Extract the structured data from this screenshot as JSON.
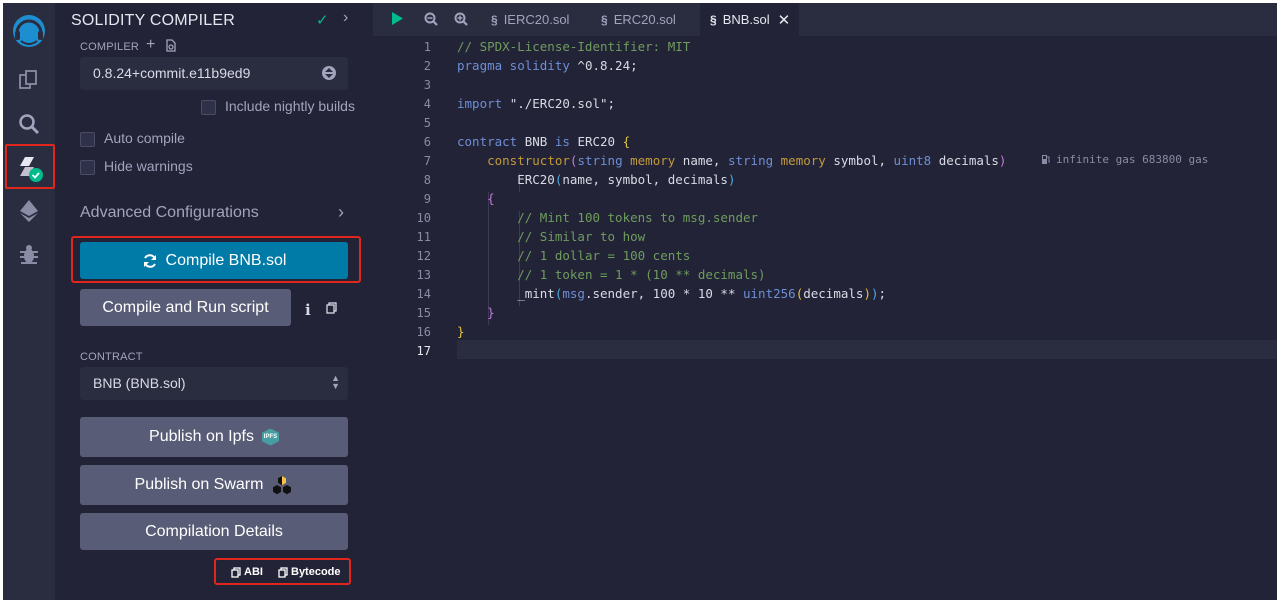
{
  "sidebar": {
    "title": "SOLIDITY COMPILER",
    "compiler_label": "COMPILER",
    "compiler_version": "0.8.24+commit.e11b9ed9",
    "include_nightly": "Include nightly builds",
    "auto_compile": "Auto compile",
    "hide_warnings": "Hide warnings",
    "advanced": "Advanced Configurations",
    "compile_button": "Compile BNB.sol",
    "compile_run_button": "Compile and Run script",
    "contract_label": "CONTRACT",
    "contract_value": "BNB (BNB.sol)",
    "publish_ipfs": "Publish on Ipfs",
    "ipfs_badge": "IPFS",
    "publish_swarm": "Publish on Swarm",
    "compilation_details": "Compilation Details",
    "abi": "ABI",
    "bytecode": "Bytecode"
  },
  "editor": {
    "tabs": [
      {
        "label": "IERC20.sol"
      },
      {
        "label": "ERC20.sol"
      },
      {
        "label": "BNB.sol"
      }
    ],
    "line_numbers": [
      "1",
      "2",
      "3",
      "4",
      "5",
      "6",
      "7",
      "8",
      "9",
      "10",
      "11",
      "12",
      "13",
      "14",
      "15",
      "16",
      "17"
    ],
    "gas_hint": "infinite gas 683800 gas"
  },
  "colors": {
    "accent": "#007aa6",
    "highlight_box": "#e1261c",
    "success": "#00bc8c"
  }
}
